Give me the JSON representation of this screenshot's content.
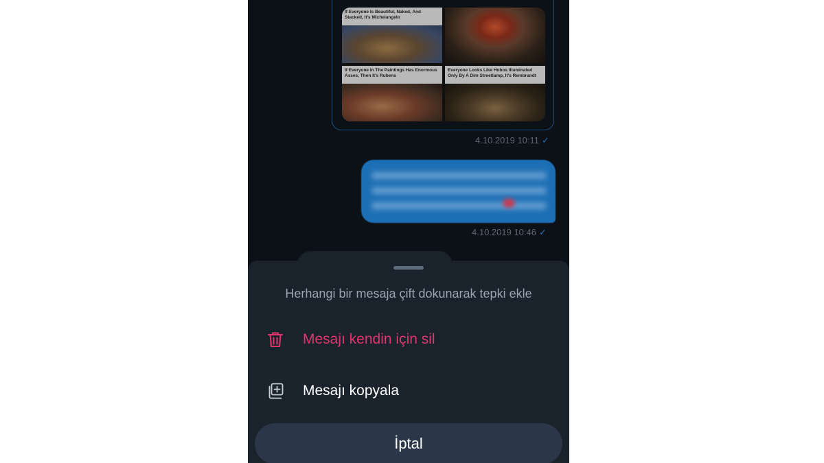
{
  "chat": {
    "image_message": {
      "captions": [
        "If Everyone Is Beautiful, Naked, And Stacked, It's Michelangelo",
        "",
        "If Everyone In The Paintings Has Enormous Asses, Then It's Rubens",
        "Everyone Looks Like Hobos Illuminated Only By A Dim Streetlamp, It's Rembrandt"
      ],
      "timestamp": "4.10.2019 10:11"
    },
    "text_message": {
      "timestamp": "4.10.2019 10:46"
    },
    "read_icon": "check-icon"
  },
  "sheet": {
    "hint": "Herhangi bir mesaja çift dokunarak tepki ekle",
    "actions": [
      {
        "label": "Mesajı kendin için sil",
        "icon": "trash-icon",
        "color": "#e0356a"
      },
      {
        "label": "Mesajı kopyala",
        "icon": "copy-icon",
        "color": "#ffffff"
      }
    ],
    "cancel": "İptal"
  },
  "colors": {
    "background": "#0c1117",
    "sheet": "#1a222c",
    "bubble": "#1d6fb5",
    "destructive": "#e0356a"
  }
}
